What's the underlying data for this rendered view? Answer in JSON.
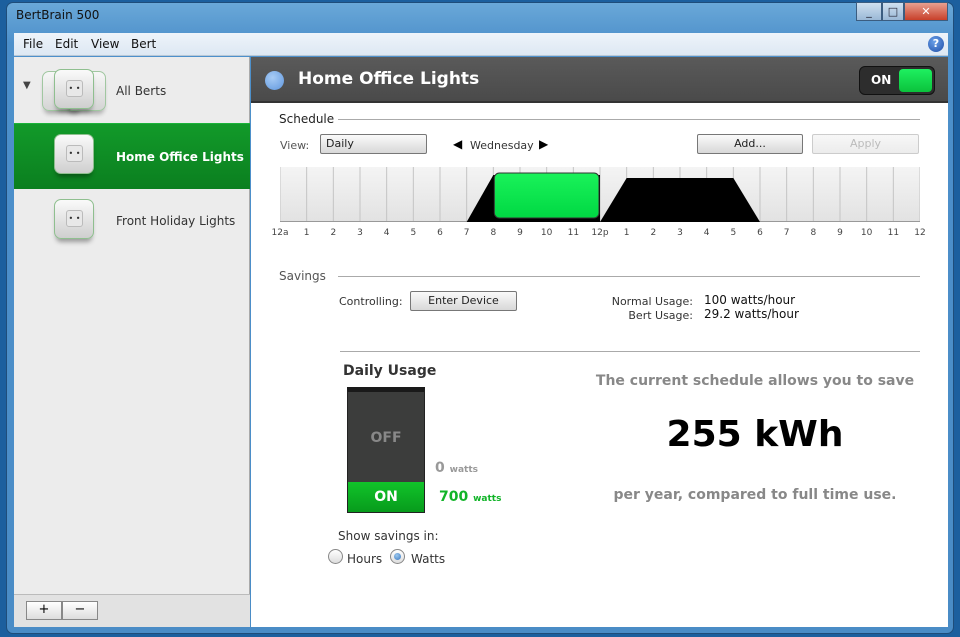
{
  "window": {
    "title": "BertBrain 500",
    "controls": [
      "minimize",
      "maximize",
      "close"
    ]
  },
  "menu": [
    "File",
    "Edit",
    "View",
    "Bert"
  ],
  "sidebar": {
    "items": [
      {
        "label": "All Berts",
        "expanded": true
      },
      {
        "label": "Home Office Lights",
        "selected": true
      },
      {
        "label": "Front Holiday Lights"
      }
    ],
    "add_label": "+",
    "remove_label": "−"
  },
  "header": {
    "title": "Home Office Lights",
    "toggle_label": "ON",
    "toggle_on": true
  },
  "schedule": {
    "section": "Schedule",
    "view_label": "View:",
    "view_value": "Daily",
    "day": "Wednesday",
    "add_label": "Add...",
    "apply_label": "Apply",
    "chart_data": {
      "type": "area",
      "x_ticks": [
        "12a",
        "1",
        "2",
        "3",
        "4",
        "5",
        "6",
        "7",
        "8",
        "9",
        "10",
        "11",
        "12p",
        "1",
        "2",
        "3",
        "4",
        "5",
        "6",
        "7",
        "8",
        "9",
        "10",
        "11",
        "12"
      ],
      "on_periods": [
        {
          "rise_start": 7,
          "on_start": 8,
          "on_end": 12,
          "fall_end": 12
        },
        {
          "rise_start": 12,
          "on_start": 13,
          "on_end": 17,
          "fall_end": 18
        }
      ],
      "selected_block": {
        "start": 8,
        "end": 12
      },
      "accent": "#00d843"
    }
  },
  "savings": {
    "section": "Savings",
    "controlling_label": "Controlling:",
    "enter_device_label": "Enter Device",
    "normal_label": "Normal Usage:",
    "normal_value": "100 watts/hour",
    "bert_label": "Bert Usage:",
    "bert_value": "29.2 watts/hour",
    "daily_title": "Daily Usage",
    "off_label": "OFF",
    "on_label": "ON",
    "off_value": "0",
    "off_unit": "watts",
    "on_value": "700",
    "on_unit": "watts",
    "show_in_label": "Show savings in:",
    "options": [
      "Hours",
      "Watts"
    ],
    "selected_option": "Watts",
    "message_top": "The current schedule allows you to save",
    "amount": "255 kWh",
    "message_bottom": "per year, compared to full time use."
  }
}
